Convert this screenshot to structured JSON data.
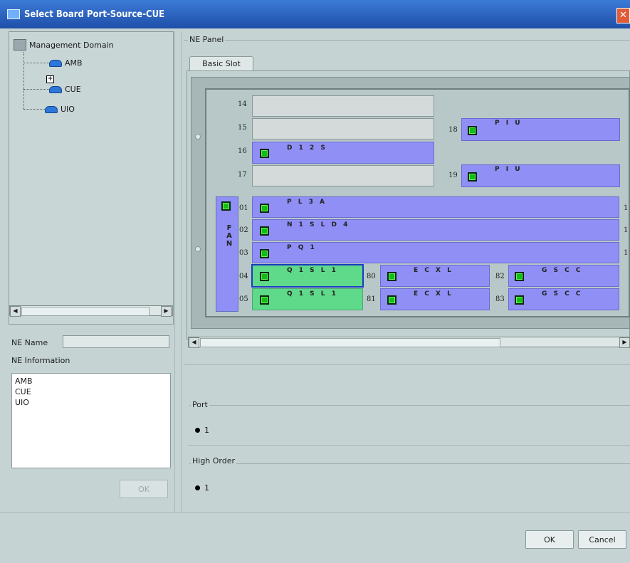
{
  "window": {
    "title": "Select Board Port-Source-CUE",
    "close_glyph": "✕"
  },
  "tree": {
    "root": "Management Domain",
    "expander": "+",
    "nodes": [
      {
        "label": "AMB"
      },
      {
        "label": "CUE"
      },
      {
        "label": "UIO"
      }
    ]
  },
  "left": {
    "ne_name_label": "NE Name",
    "ne_name_value": "",
    "ne_info_label": "NE Information",
    "ne_info_items": [
      "AMB",
      "CUE",
      "UIO"
    ],
    "ok_label": "OK",
    "scroll_left": "◀",
    "scroll_right": "▶"
  },
  "ne_panel": {
    "title": "NE Panel",
    "tab": "Basic Slot",
    "fan_label": "FAN",
    "slots": {
      "s14": "14",
      "s15": "15",
      "s16": "16",
      "s17": "17",
      "s18": "18",
      "s19": "19",
      "s01": "01",
      "s02": "02",
      "s03": "03",
      "s04": "04",
      "s05": "05",
      "s80": "80",
      "s81": "81",
      "s82": "82",
      "s83": "83"
    },
    "boards": {
      "b16": "D 1 2 S",
      "b18": "P I U",
      "b19": "P I U",
      "b01": "P L 3 A",
      "b02": "N 1 S L D 4",
      "b03": "P Q 1",
      "b04": "Q 1 S L 1",
      "b05": "Q 1 S L 1",
      "b80": "E C X L",
      "b81": "E C X L",
      "b82": "G S C C",
      "b83": "G S C C"
    },
    "edge_digit": "1"
  },
  "port": {
    "title": "Port",
    "option": "1"
  },
  "high_order": {
    "title": "High Order",
    "option": "1"
  },
  "footer": {
    "ok": "OK",
    "cancel": "Cancel"
  },
  "colors": {
    "board": "#8f8ff6",
    "board_selected": "#5fd98a",
    "led": "#10c010",
    "titlebar": "#2a62c0"
  }
}
